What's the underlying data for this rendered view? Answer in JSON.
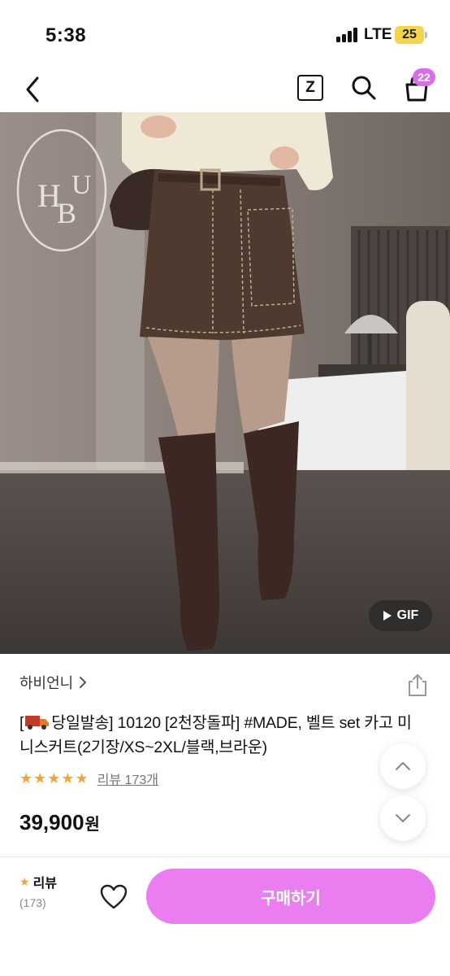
{
  "status_bar": {
    "time": "5:38",
    "network": "LTE",
    "battery": "25"
  },
  "nav": {
    "back_icon": "chevron-left-icon",
    "z_label": "Z",
    "search_icon": "search-icon",
    "cart_icon": "shopping-bag-icon",
    "cart_badge": "22"
  },
  "product": {
    "watermark": "HBU",
    "gif_label": "GIF",
    "shop_name": "하비언니",
    "title_before_icon": "[",
    "title_after_icon": "당일발송] 10120 [2천장돌파] #MADE, 벨트 set 카고 미니스커트(2기장/XS~2XL/블랙,브라운)",
    "rating_stars": 5,
    "review_link": "리뷰 173개",
    "price": "39,900",
    "price_unit": "원"
  },
  "bottom_bar": {
    "review_label": "리뷰",
    "review_count": "(173)",
    "buy_label": "구매하기"
  },
  "colors": {
    "accent": "#ea7ef0",
    "badge": "#d770e8",
    "star": "#f4a531",
    "battery": "#f2d54a"
  }
}
